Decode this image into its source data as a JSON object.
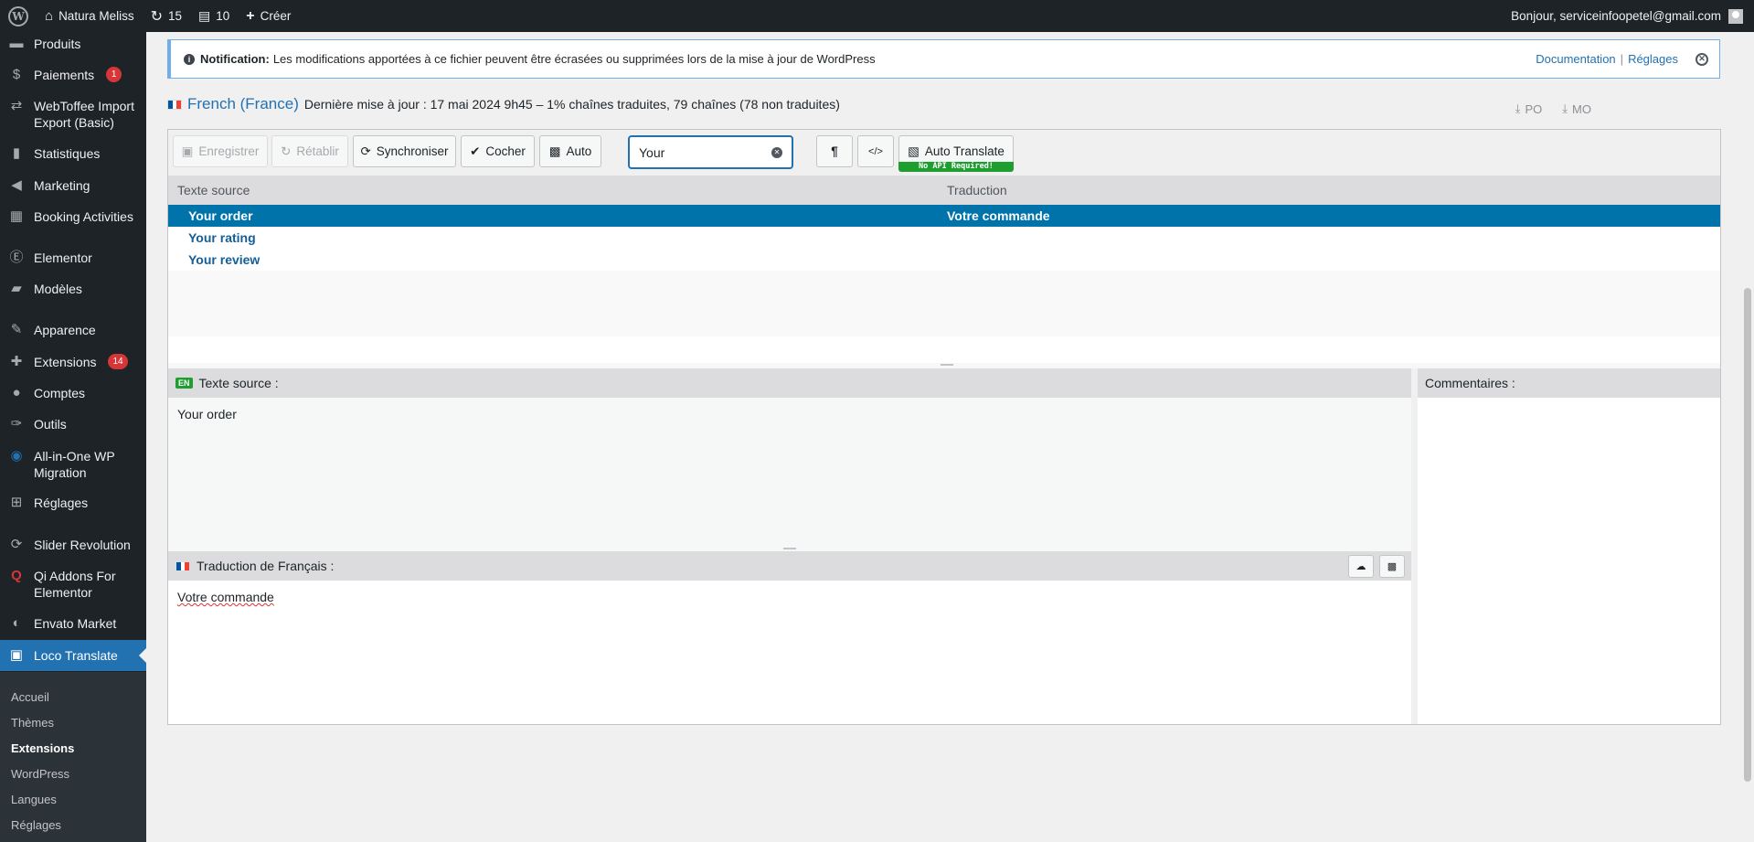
{
  "adminbar": {
    "site_name": "Natura Meliss",
    "updates_count": "15",
    "comments_count": "10",
    "new_label": "Créer",
    "greeting": "Bonjour, serviceinfoopetel@gmail.com"
  },
  "sidebar": {
    "items": [
      {
        "label": "Produits",
        "icon": "archive-icon"
      },
      {
        "label": "Paiements",
        "icon": "dollar-icon",
        "badge": "1"
      },
      {
        "label": "WebToffee Import Export (Basic)",
        "icon": "import-export-icon"
      },
      {
        "label": "Statistiques",
        "icon": "bar-chart-icon"
      },
      {
        "label": "Marketing",
        "icon": "megaphone-icon"
      },
      {
        "label": "Booking Activities",
        "icon": "calendar-icon"
      },
      {
        "label": "Elementor",
        "icon": "elementor-icon"
      },
      {
        "label": "Modèles",
        "icon": "folder-icon"
      },
      {
        "label": "Apparence",
        "icon": "brush-icon"
      },
      {
        "label": "Extensions",
        "icon": "plugin-icon",
        "badge": "14"
      },
      {
        "label": "Comptes",
        "icon": "user-icon"
      },
      {
        "label": "Outils",
        "icon": "wrench-icon"
      },
      {
        "label": "All-in-One WP Migration",
        "icon": "migration-icon"
      },
      {
        "label": "Réglages",
        "icon": "settings-icon"
      },
      {
        "label": "Slider Revolution",
        "icon": "refresh-icon"
      },
      {
        "label": "Qi Addons For Elementor",
        "icon": "qi-icon"
      },
      {
        "label": "Envato Market",
        "icon": "leaf-icon"
      },
      {
        "label": "Loco Translate",
        "icon": "translate-icon"
      }
    ],
    "submenu": [
      "Accueil",
      "Thèmes",
      "Extensions",
      "WordPress",
      "Langues",
      "Réglages"
    ]
  },
  "notice": {
    "label": "Notification:",
    "text": "Les modifications apportées à ce fichier peuvent être écrasées ou supprimées lors de la mise à jour de WordPress",
    "link_docs": "Documentation",
    "separator": "|",
    "link_settings": "Réglages"
  },
  "header": {
    "language": "French (France)",
    "meta": "Dernière mise à jour : 17 mai 2024 9h45 – 1% chaînes traduites, 79 chaînes (78 non traduites)",
    "download_po": "PO",
    "download_mo": "MO"
  },
  "flag_colors": [
    "#0055a4",
    "#ffffff",
    "#ef4135"
  ],
  "toolbar": {
    "save": "Enregistrer",
    "revert": "Rétablir",
    "sync": "Synchroniser",
    "fuzzy": "Cocher",
    "auto": "Auto",
    "search_value": "Your",
    "pilcrow": "¶",
    "code": "</>",
    "auto_translate": "Auto Translate",
    "no_api": "No API Required!"
  },
  "grid": {
    "columns": [
      "Texte source",
      "Traduction"
    ],
    "rows": [
      {
        "source": "Your order",
        "translation": "Votre commande",
        "selected": true
      },
      {
        "source": "Your rating",
        "translation": ""
      },
      {
        "source": "Your review",
        "translation": ""
      }
    ]
  },
  "source_pane": {
    "lang_code": "EN",
    "title": "Texte source :",
    "text": "Your order"
  },
  "translation_pane": {
    "title": "Traduction de Français :",
    "text": "Votre commande"
  },
  "comments_pane": {
    "title": "Commentaires :"
  },
  "colors": {
    "accent": "#2271b1",
    "selected_row": "#0073aa",
    "adminbar": "#1d2327",
    "badge": "#d63638",
    "no_api_green": "#1e9e2f"
  }
}
